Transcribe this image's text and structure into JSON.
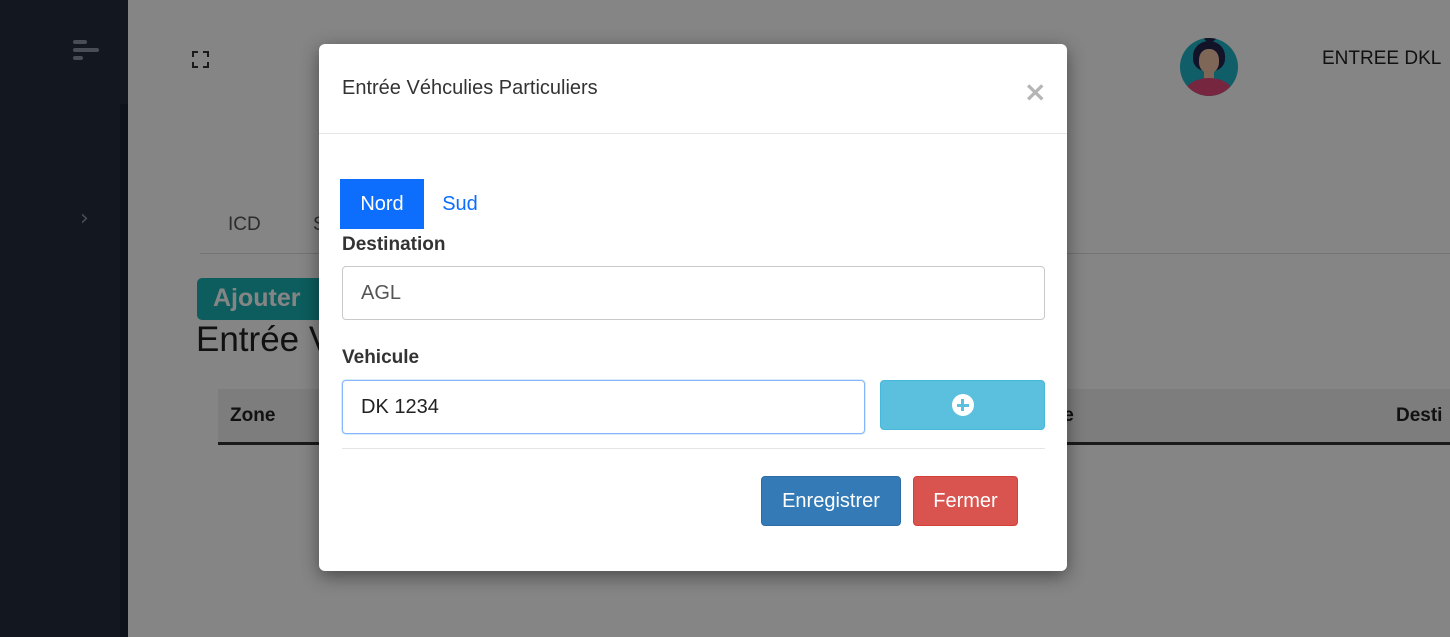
{
  "header": {
    "title": "ENTREE DKL"
  },
  "page": {
    "tabs": [
      "ICD",
      "S"
    ],
    "add_button": "Ajouter",
    "heading": "Entrée V",
    "table_headers": [
      "Zone",
      "le",
      "Desti"
    ]
  },
  "modal": {
    "title": "Entrée Véhculies Particuliers",
    "close_symbol": "×",
    "pills": {
      "nord": "Nord",
      "sud": "Sud"
    },
    "destination": {
      "label": "Destination",
      "value": "AGL"
    },
    "vehicule": {
      "label": "Vehicule",
      "value": "DK 1234"
    },
    "buttons": {
      "save": "Enregistrer",
      "close": "Fermer"
    }
  },
  "colors": {
    "sidebar_bg": "#232d3e",
    "primary": "#0d6efd",
    "info": "#5bc0de",
    "save": "#337ab7",
    "danger": "#d9534f",
    "add_button": "#1ab3b4"
  },
  "icons": [
    "hamburger-icon",
    "chevron-right-icon",
    "fullscreen-icon",
    "avatar",
    "close-icon",
    "plus-circle-icon"
  ]
}
